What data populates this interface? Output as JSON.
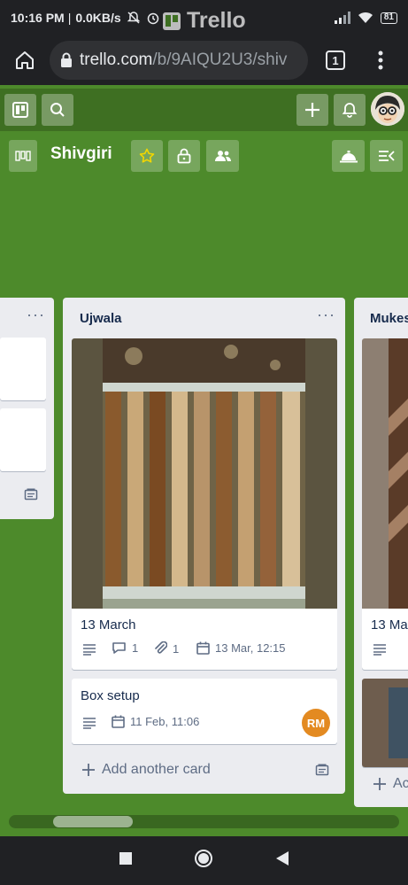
{
  "status": {
    "time": "10:16 PM",
    "speed": "0.0KB/s",
    "battery": "81"
  },
  "browser": {
    "url_host": "trello.com",
    "url_path": "/b/9AIQU2U3/shiv",
    "tab_count": "1"
  },
  "header": {
    "logo_text": "Trello"
  },
  "board": {
    "title": "Shivgiri"
  },
  "lists": [
    {
      "title": "Ujwala",
      "cards": [
        {
          "title": "13 March",
          "comments": "1",
          "attachments": "1",
          "due": "13 Mar, 12:15"
        },
        {
          "title": "Box setup",
          "due": "11 Feb, 11:06",
          "member": "RM"
        }
      ],
      "add_card_label": "Add another card"
    },
    {
      "title": "Mukes",
      "cards": [
        {
          "title": "13 Ma"
        }
      ],
      "add_card_label": "Ac"
    }
  ],
  "colors": {
    "board_bg": "#4d8a2b",
    "header_bg": "#3e6f22",
    "list_bg": "#ebecf0",
    "member": "#e38a21",
    "star": "#f2d600"
  }
}
